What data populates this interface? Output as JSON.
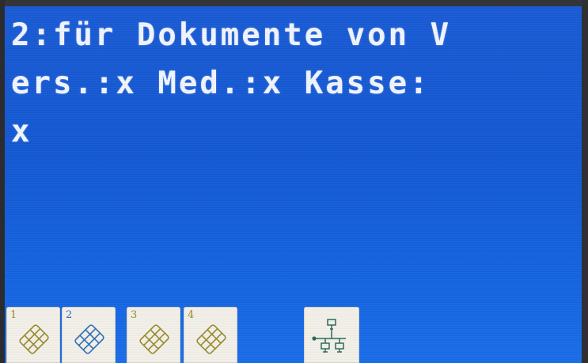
{
  "screen": {
    "message_lines": [
      "2:für Dokumente von V",
      "ers.:x Med.:x Kasse:",
      "x"
    ],
    "text_color": "#f2f6ff",
    "background_color": "#1459d4"
  },
  "softkeys": [
    {
      "number": "1",
      "icon": "card-chip-icon",
      "color": "#9a8a2a"
    },
    {
      "number": "2",
      "icon": "card-chip-icon",
      "color": "#2e6fb8"
    },
    {
      "number": "3",
      "icon": "card-chip-icon",
      "color": "#9a8a2a"
    },
    {
      "number": "4",
      "icon": "card-chip-icon",
      "color": "#9a8a2a"
    },
    {
      "icon": "network-icon",
      "color": "#2c6b5a"
    }
  ]
}
